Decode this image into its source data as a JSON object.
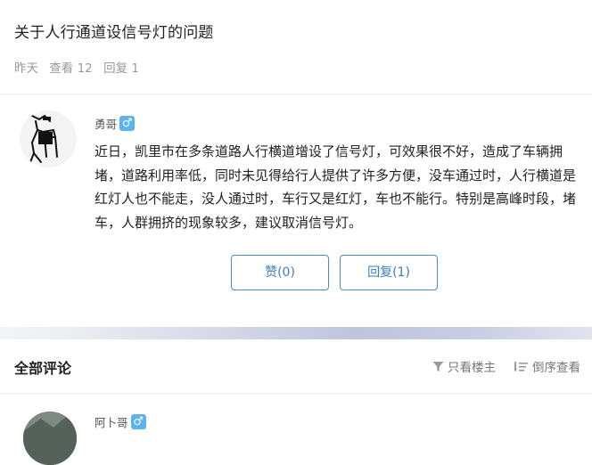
{
  "post": {
    "title": "关于人行通道设信号灯的问题",
    "time": "昨天",
    "views": "查看 12",
    "replies": "回复 1",
    "author": "勇哥",
    "gender_symbol": "♂",
    "content": "近日，凯里市在多条道路人行横道增设了信号灯，可效果很不好，造成了车辆拥堵，道路利用率低，同时未见得给行人提供了许多方便，没车通过时，人行横道是红灯人也不能走，没人通过时，车行又是红灯，车也不能行。特别是高峰时段，堵车，人群拥挤的现象较多，建议取消信号灯。"
  },
  "actions": {
    "like_label": "赞(0)",
    "reply_label": "回复(1)"
  },
  "comments": {
    "section_title": "全部评论",
    "only_host_label": "只看楼主",
    "reverse_label": "倒序查看",
    "first": {
      "author": "阿卜哥",
      "gender_symbol": "♂"
    }
  },
  "colors": {
    "accent": "#3b7fc4",
    "gender_badge": "#5bb3ee",
    "muted_text": "#9a9a9a"
  },
  "icons": {
    "filter": "filter-icon",
    "sort": "sort-icon",
    "male": "male-icon"
  }
}
